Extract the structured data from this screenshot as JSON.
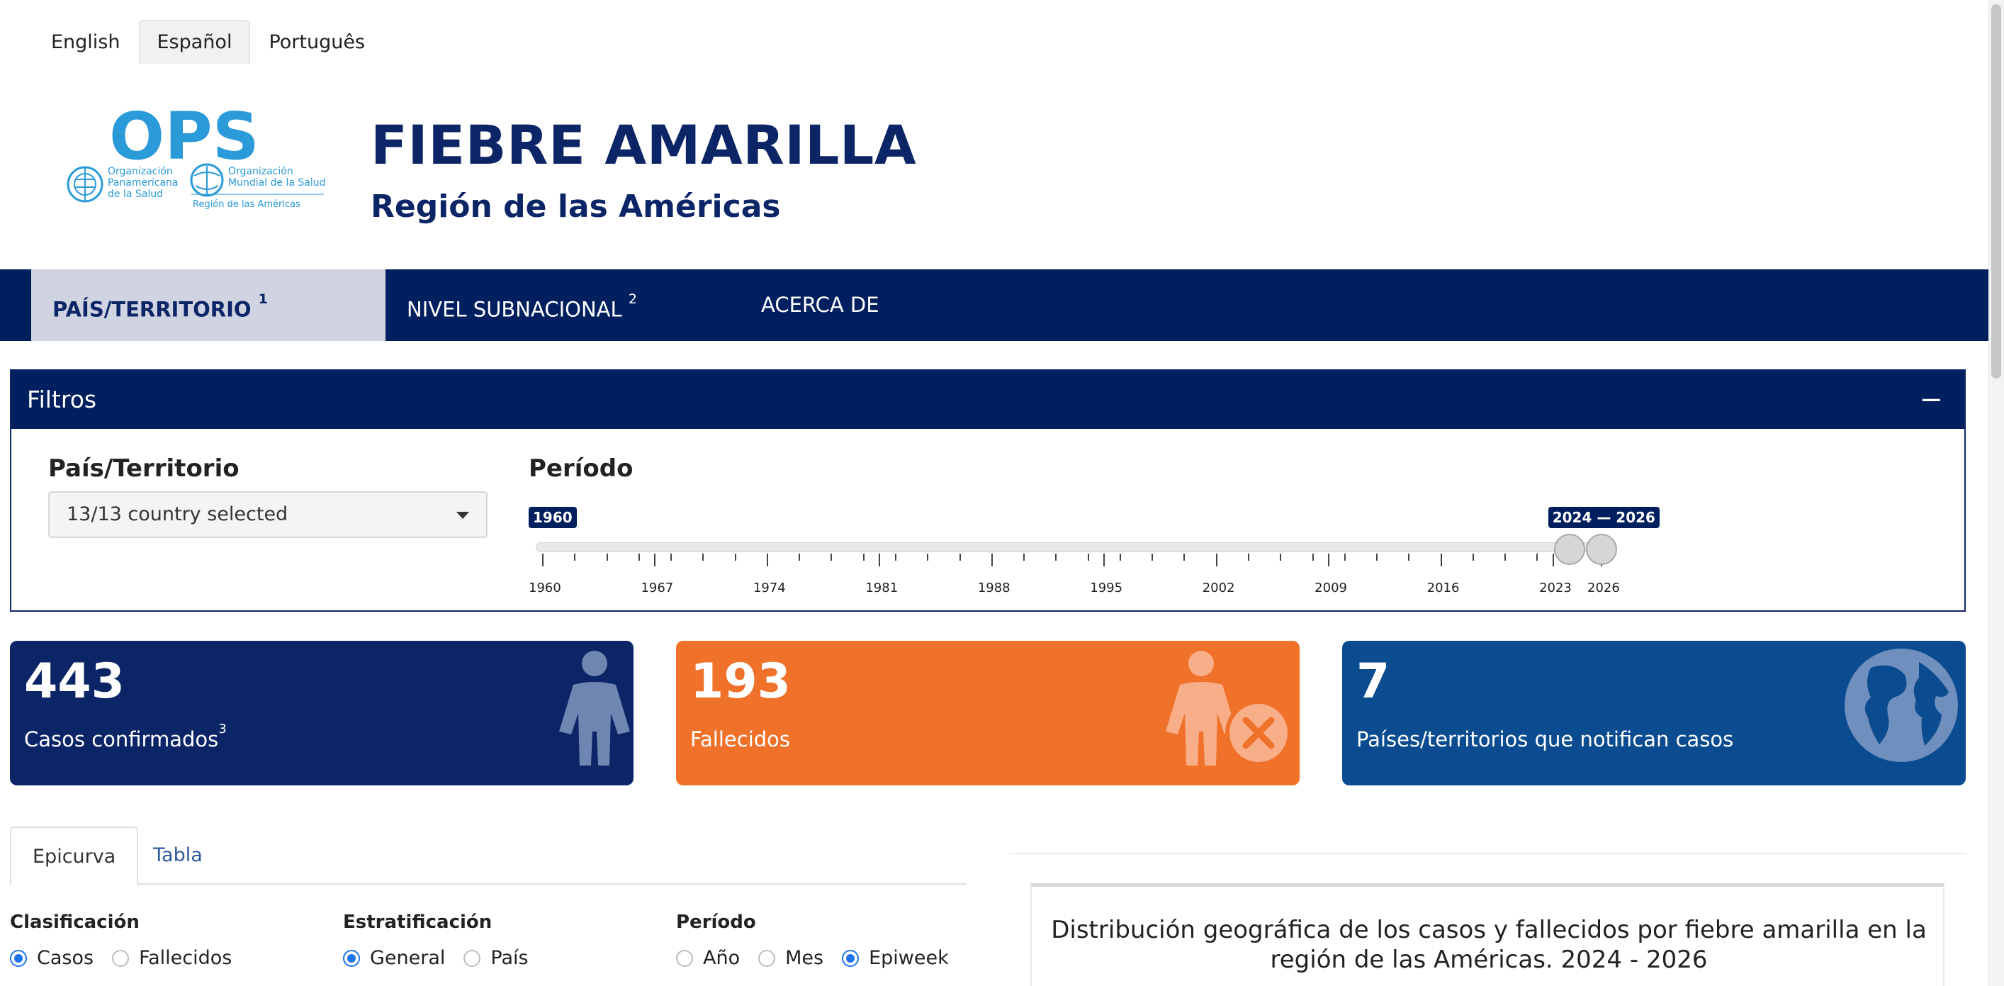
{
  "languages": [
    "English",
    "Español",
    "Português"
  ],
  "active_language": "Español",
  "logo": {
    "acronym": "OPS",
    "org1": [
      "Organización",
      "Panamericana",
      "de la Salud"
    ],
    "org2": [
      "Organización",
      "Mundial de la Salud"
    ],
    "region": "Región de las Américas"
  },
  "header": {
    "title": "FIEBRE AMARILLA",
    "subtitle": "Región de las Américas"
  },
  "nav": [
    {
      "label": "PAÍS/TERRITORIO",
      "sup": "1"
    },
    {
      "label": "NIVEL SUBNACIONAL",
      "sup": "2"
    },
    {
      "label": "ACERCA DE",
      "sup": ""
    }
  ],
  "filters": {
    "title": "Filtros",
    "collapse_icon": "minus",
    "country_label": "País/Territorio",
    "country_value": "13/13 country selected",
    "period_label": "Período",
    "slider_min_chip": "1960",
    "slider_range_chip": "2024 — 2026",
    "slider_min": 1960,
    "slider_max": 2026,
    "slider_from": 2024,
    "slider_to": 2026,
    "tick_labels": [
      "1960",
      "1967",
      "1974",
      "1981",
      "1988",
      "1995",
      "2002",
      "2009",
      "2016",
      "2023",
      "2026"
    ]
  },
  "kpis": [
    {
      "value": "443",
      "caption": "Casos confirmados",
      "sup": "3",
      "color": "#0b2566",
      "icon": "person-icon"
    },
    {
      "value": "193",
      "caption": "Fallecidos",
      "sup": "",
      "color": "#f07129",
      "icon": "person-deceased-icon"
    },
    {
      "value": "7",
      "caption": "Países/territorios que notifican casos",
      "sup": "",
      "color": "#0b4b8f",
      "icon": "globe-icon"
    }
  ],
  "bottom_tabs": [
    "Epicurva",
    "Tabla"
  ],
  "controls": {
    "clasificacion": {
      "label": "Clasificación",
      "options": [
        "Casos",
        "Fallecidos"
      ],
      "selected": "Casos"
    },
    "estratificacion": {
      "label": "Estratificación",
      "options": [
        "General",
        "País"
      ],
      "selected": "General"
    },
    "periodo": {
      "label": "Período",
      "options": [
        "Año",
        "Mes",
        "Epiweek"
      ],
      "selected": "Epiweek"
    }
  },
  "map_title": [
    "Distribución geográfica de los casos y fallecidos por fiebre amarilla en la",
    "región de las Américas. 2024 - 2026"
  ]
}
